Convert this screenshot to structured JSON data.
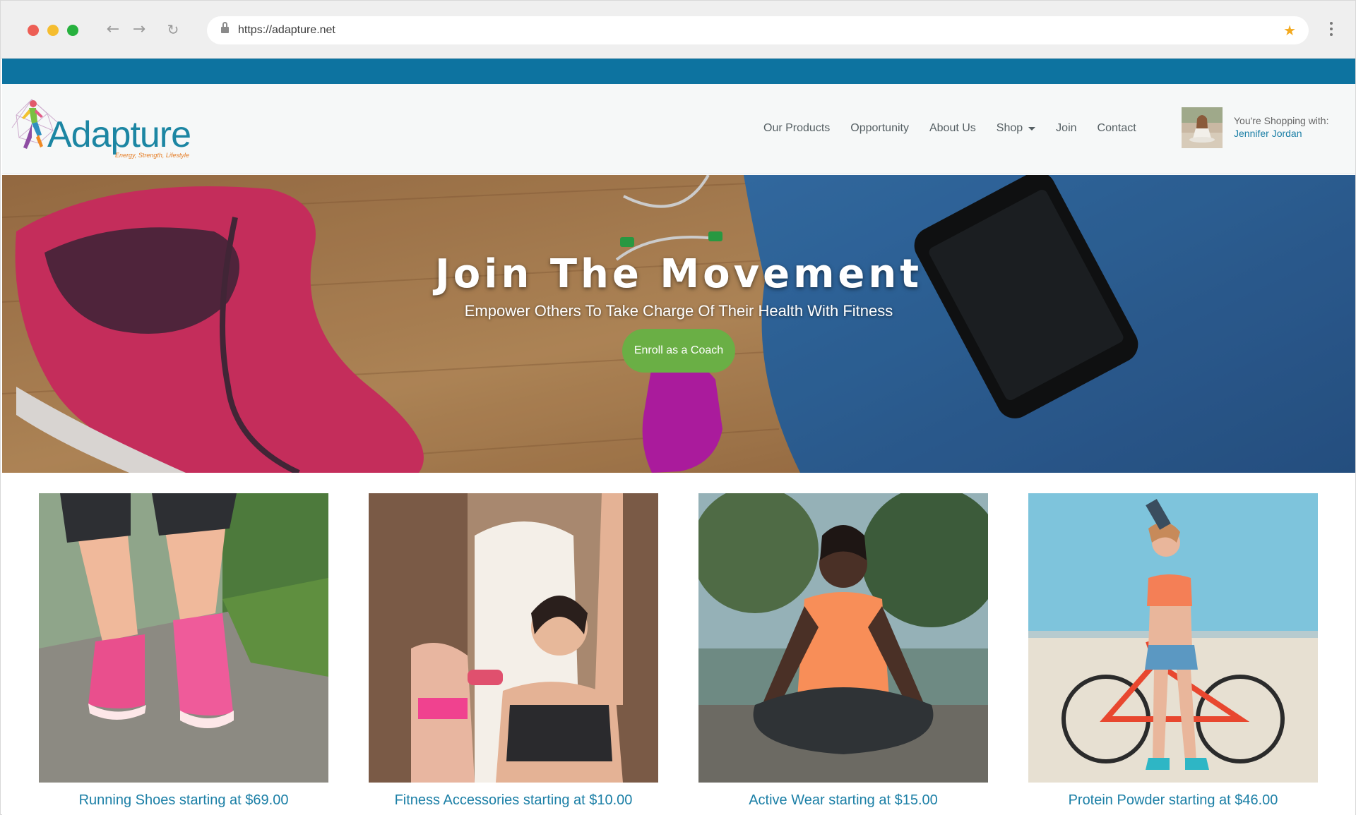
{
  "browser": {
    "url": "https://adapture.net"
  },
  "brand": {
    "name": "Adapture",
    "tagline": "Energy, Strength, Lifestyle",
    "primary_color": "#0d73a0",
    "accent_color": "#6aaf45"
  },
  "nav": {
    "items": [
      {
        "label": "Our Products"
      },
      {
        "label": "Opportunity"
      },
      {
        "label": "About Us"
      },
      {
        "label": "Shop"
      },
      {
        "label": "Join"
      },
      {
        "label": "Contact"
      }
    ]
  },
  "shopping_with": {
    "label": "You're Shopping with:",
    "name": "Jennifer Jordan"
  },
  "hero": {
    "title": "Join The Movement",
    "subtitle": "Empower Others To Take Charge Of Their Health With Fitness",
    "cta_label": "Enroll as a Coach"
  },
  "products": [
    {
      "caption": "Running Shoes starting at $69.00"
    },
    {
      "caption": "Fitness Accessories starting at $10.00"
    },
    {
      "caption": "Active Wear starting at $15.00"
    },
    {
      "caption": "Protein Powder starting at $46.00"
    }
  ],
  "icons": {
    "back": "arrow-left-icon",
    "forward": "arrow-right-icon",
    "reload": "reload-icon",
    "lock": "lock-icon",
    "bookmark": "star-icon",
    "menu": "kebab-menu-icon",
    "shop_dropdown": "caret-down-icon"
  }
}
